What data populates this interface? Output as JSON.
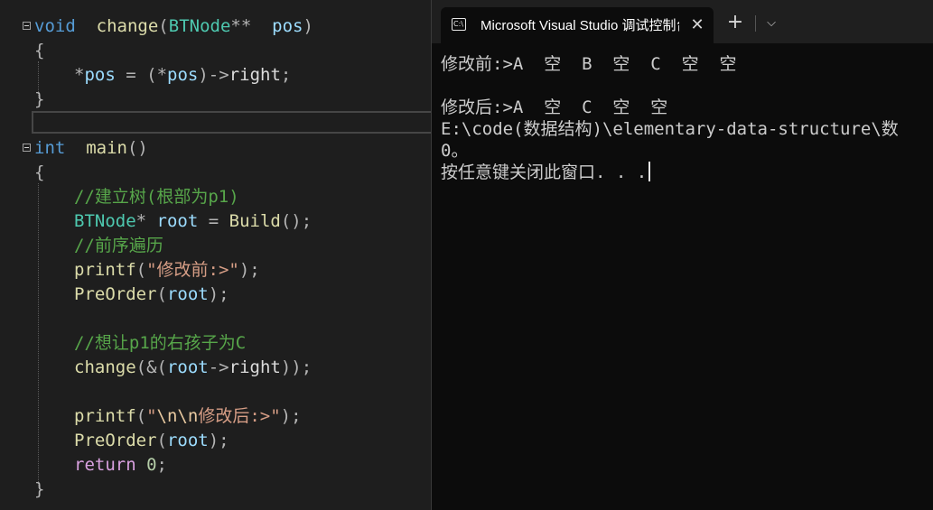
{
  "editor": {
    "lines": [
      {
        "id": "l1",
        "tokens": [
          [
            "kw",
            "void"
          ],
          [
            "",
            "  "
          ],
          [
            "fn",
            "change"
          ],
          [
            "pun",
            "("
          ],
          [
            "ty",
            "BTNode"
          ],
          [
            "op",
            "**"
          ],
          [
            "",
            "  "
          ],
          [
            "pm",
            "pos"
          ],
          [
            "pun",
            ")"
          ]
        ]
      },
      {
        "id": "l2",
        "tokens": [
          [
            "pun",
            "{"
          ]
        ]
      },
      {
        "id": "l3",
        "tokens": [
          [
            "op",
            "*"
          ],
          [
            "pm",
            "pos"
          ],
          [
            "",
            ""
          ],
          [
            "op",
            " = "
          ],
          [
            "pun",
            "("
          ],
          [
            "op",
            "*"
          ],
          [
            "pm",
            "pos"
          ],
          [
            "pun",
            ")"
          ],
          [
            "op",
            "->"
          ],
          [
            "",
            "right"
          ],
          [
            "pun",
            ";"
          ]
        ]
      },
      {
        "id": "l4",
        "tokens": [
          [
            "pun",
            "}"
          ]
        ]
      },
      {
        "id": "l5",
        "tokens": []
      },
      {
        "id": "l6",
        "tokens": [
          [
            "kw",
            "int"
          ],
          [
            "",
            "  "
          ],
          [
            "fn",
            "main"
          ],
          [
            "pun",
            "()"
          ]
        ]
      },
      {
        "id": "l7",
        "tokens": [
          [
            "pun",
            "{"
          ]
        ]
      },
      {
        "id": "l8",
        "tokens": [
          [
            "cm",
            "//建立树(根部为p1)"
          ]
        ]
      },
      {
        "id": "l9",
        "tokens": [
          [
            "ty",
            "BTNode"
          ],
          [
            "op",
            "*"
          ],
          [
            "",
            ""
          ],
          [
            "pm",
            " root"
          ],
          [
            "op",
            " = "
          ],
          [
            "fn",
            "Build"
          ],
          [
            "pun",
            "();"
          ]
        ]
      },
      {
        "id": "l10",
        "tokens": [
          [
            "cm",
            "//前序遍历"
          ]
        ]
      },
      {
        "id": "l11",
        "tokens": [
          [
            "fn",
            "printf"
          ],
          [
            "pun",
            "("
          ],
          [
            "str",
            "\"修改前:>\""
          ],
          [
            "pun",
            ");"
          ]
        ]
      },
      {
        "id": "l12",
        "tokens": [
          [
            "fn",
            "PreOrder"
          ],
          [
            "pun",
            "("
          ],
          [
            "pm",
            "root"
          ],
          [
            "pun",
            ");"
          ]
        ]
      },
      {
        "id": "l13",
        "tokens": []
      },
      {
        "id": "l14",
        "tokens": [
          [
            "cm",
            "//想让p1的右孩子为C"
          ]
        ]
      },
      {
        "id": "l15",
        "tokens": [
          [
            "fn",
            "change"
          ],
          [
            "pun",
            "(&("
          ],
          [
            "pm",
            "root"
          ],
          [
            "op",
            "->"
          ],
          [
            "",
            "right"
          ],
          [
            "pun",
            "));"
          ]
        ]
      },
      {
        "id": "l16",
        "tokens": []
      },
      {
        "id": "l17",
        "tokens": [
          [
            "fn",
            "printf"
          ],
          [
            "pun",
            "("
          ],
          [
            "str",
            "\""
          ],
          [
            "esc",
            "\\n\\n"
          ],
          [
            "str",
            "修改后:>\""
          ],
          [
            "pun",
            ");"
          ]
        ]
      },
      {
        "id": "l18",
        "tokens": [
          [
            "fn",
            "PreOrder"
          ],
          [
            "pun",
            "("
          ],
          [
            "pm",
            "root"
          ],
          [
            "pun",
            ");"
          ]
        ]
      },
      {
        "id": "l19",
        "tokens": [
          [
            "ctl",
            "return"
          ],
          [
            "",
            ""
          ],
          [
            "num",
            " 0"
          ],
          [
            "pun",
            ";"
          ]
        ]
      },
      {
        "id": "l20",
        "tokens": [
          [
            "pun",
            "}"
          ]
        ]
      }
    ]
  },
  "console": {
    "tab_title": "Microsoft Visual Studio 调试控制台",
    "tab_icon_glyph": "C:\\",
    "close_glyph": "✕",
    "new_tab_glyph": "+",
    "dropdown_glyph": "⌵",
    "output": [
      "修改前:>A  空  B  空  C  空  空",
      "",
      "修改后:>A  空  C  空  空",
      "E:\\code(数据结构)\\elementary-data-structure\\数",
      "0。",
      "按任意键关闭此窗口. . ."
    ]
  },
  "colors": {
    "editor_bg": "#1e1e1e",
    "console_bg": "#0c0c0c",
    "keyword": "#569cd6",
    "type": "#4ec9b0",
    "function": "#dcdcaa",
    "comment": "#57a64a",
    "string": "#d69d85"
  }
}
